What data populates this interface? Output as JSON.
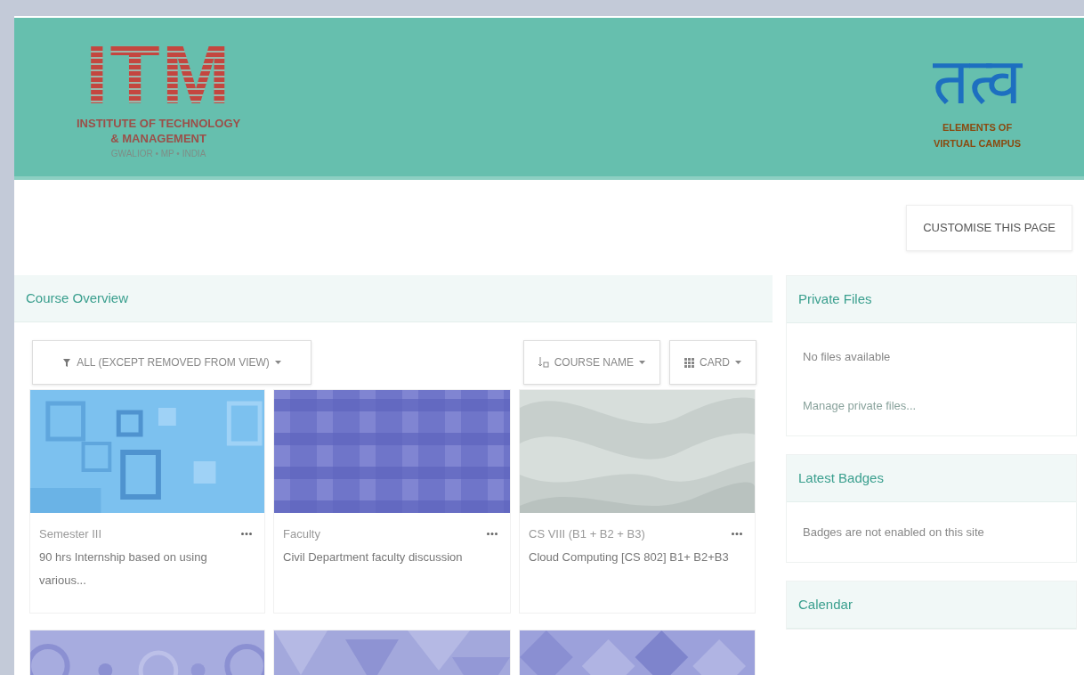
{
  "header": {
    "logo_left": {
      "letters": "ITM",
      "lines": [
        "INSTITUTE OF TECHNOLOGY",
        "& MANAGEMENT",
        "GWALIOR • MP • INDIA"
      ]
    },
    "logo_right": {
      "mark": "तत्व",
      "lines": [
        "ELEMENTS OF",
        "VIRTUAL CAMPUS"
      ]
    }
  },
  "customise_button": "CUSTOMISE THIS PAGE",
  "course_overview": {
    "title": "Course Overview",
    "filters": [
      {
        "label": "ALL (EXCEPT REMOVED FROM VIEW)",
        "kind": "filter"
      },
      {
        "label": "COURSE NAME",
        "kind": "sort"
      },
      {
        "label": "CARD",
        "kind": "view"
      }
    ],
    "courses": [
      {
        "kind": "picture",
        "category": "Semester III",
        "name": "90 hrs Internship based on using various..."
      },
      {
        "kind": "picture",
        "category": "Faculty",
        "name": "Civil Department faculty discussion"
      },
      {
        "kind": "picture",
        "category": "CS VIII (B1 + B2 + B3)",
        "name": "Cloud Computing [CS 802] B1+ B2+B3"
      },
      {
        "kind": "picture"
      },
      {
        "kind": "picture"
      },
      {
        "kind": "picture"
      }
    ]
  },
  "blocks": [
    {
      "title": "Private Files",
      "items": [
        {
          "kind": "text",
          "text": "No files available"
        },
        {
          "kind": "link",
          "text": "Manage private files..."
        }
      ]
    },
    {
      "title": "Latest Badges",
      "items": [
        {
          "kind": "text",
          "text": "Badges are not enabled on this site"
        }
      ]
    },
    {
      "title": "Calendar"
    }
  ]
}
